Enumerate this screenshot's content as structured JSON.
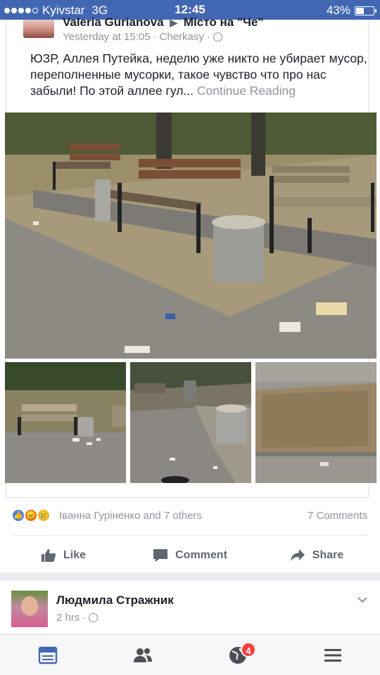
{
  "status_bar": {
    "carrier": "Kyivstar",
    "network": "3G",
    "time": "12:45",
    "battery_text": "43%",
    "battery_level": 0.43
  },
  "post": {
    "author": "Valeria Gurianova",
    "group": "Місто на \"Че\"",
    "timestamp": "Yesterday at 15:05",
    "location": "Cherkasy",
    "text": "ЮЗР, Аллея Путейка,  неделю уже никто не убирает мусор,  переполненные мусорки,  такое чувство что про нас забыли! По этой аллее гул... ",
    "continue_label": "Continue Reading",
    "reactions_names": "Іванна Гуріненко and 7 others",
    "comments_count": "7 Comments",
    "actions": {
      "like": "Like",
      "comment": "Comment",
      "share": "Share"
    }
  },
  "next_post": {
    "author": "Людмила Стражник",
    "timestamp": "2 hrs"
  },
  "nav": {
    "notifications_badge": "4"
  },
  "colors": {
    "brand": "#4267b2",
    "meta": "#90949c",
    "text": "#1d2129",
    "badge": "#fa3e3e"
  }
}
